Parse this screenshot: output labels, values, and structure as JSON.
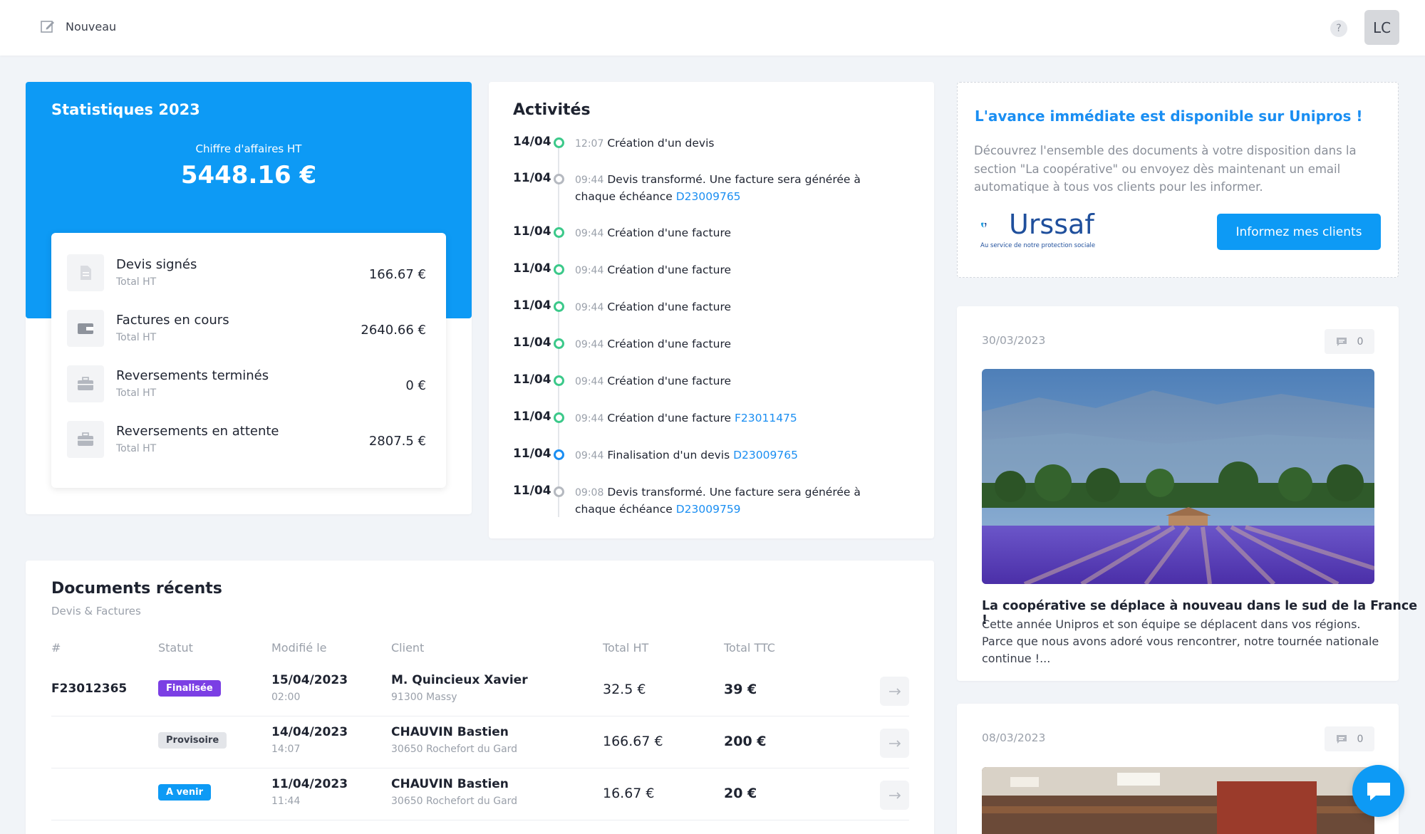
{
  "topbar": {
    "new_label": "Nouveau",
    "help_label": "?",
    "avatar_initials": "LC"
  },
  "stats": {
    "title": "Statistiques 2023",
    "ca_label": "Chiffre d'affaires HT",
    "ca_value": "5448.16 €",
    "rows": [
      {
        "name": "Devis signés",
        "sub": "Total HT",
        "value": "166.67 €",
        "icon": "document-icon"
      },
      {
        "name": "Factures en cours",
        "sub": "Total HT",
        "value": "2640.66 €",
        "icon": "wallet-icon"
      },
      {
        "name": "Reversements terminés",
        "sub": "Total HT",
        "value": "0 €",
        "icon": "briefcase-icon"
      },
      {
        "name": "Reversements en attente",
        "sub": "Total HT",
        "value": "2807.5 €",
        "icon": "briefcase-icon"
      }
    ]
  },
  "activities": {
    "title": "Activités",
    "items": [
      {
        "date": "14/04",
        "time": "12:07",
        "text": "Création d'un devis",
        "link": "",
        "dot": "green"
      },
      {
        "date": "11/04",
        "time": "09:44",
        "text": "Devis transformé. Une facture sera générée à chaque échéance",
        "link": "D23009765",
        "dot": "grey"
      },
      {
        "date": "11/04",
        "time": "09:44",
        "text": "Création d'une facture",
        "link": "",
        "dot": "green"
      },
      {
        "date": "11/04",
        "time": "09:44",
        "text": "Création d'une facture",
        "link": "",
        "dot": "green"
      },
      {
        "date": "11/04",
        "time": "09:44",
        "text": "Création d'une facture",
        "link": "",
        "dot": "green"
      },
      {
        "date": "11/04",
        "time": "09:44",
        "text": "Création d'une facture",
        "link": "",
        "dot": "green"
      },
      {
        "date": "11/04",
        "time": "09:44",
        "text": "Création d'une facture",
        "link": "",
        "dot": "green"
      },
      {
        "date": "11/04",
        "time": "09:44",
        "text": "Création d'une facture",
        "link": "F23011475",
        "dot": "green"
      },
      {
        "date": "11/04",
        "time": "09:44",
        "text": "Finalisation d'un devis",
        "link": "D23009765",
        "dot": "blue"
      },
      {
        "date": "11/04",
        "time": "09:08",
        "text": "Devis transformé. Une facture sera générée à chaque échéance",
        "link": "D23009759",
        "dot": "grey"
      }
    ]
  },
  "documents": {
    "title": "Documents récents",
    "subtitle": "Devis & Factures",
    "headers": [
      "#",
      "Statut",
      "Modifié le",
      "Client",
      "Total HT",
      "Total TTC"
    ],
    "rows": [
      {
        "num": "F23012365",
        "status": "Finalisée",
        "status_color": "#7b3fe4",
        "date": "15/04/2023",
        "time": "02:00",
        "client": "M. Quincieux Xavier",
        "address": "91300 Massy",
        "ht": "32.5 €",
        "ttc": "39 €"
      },
      {
        "num": "",
        "status": "Provisoire",
        "status_color": "#e3e5e9",
        "date": "14/04/2023",
        "time": "14:07",
        "client": "CHAUVIN Bastien",
        "address": "30650 Rochefort du Gard",
        "ht": "166.67 €",
        "ttc": "200 €"
      },
      {
        "num": "",
        "status": "A venir",
        "status_color": "#0d9af5",
        "date": "11/04/2023",
        "time": "11:44",
        "client": "CHAUVIN Bastien",
        "address": "30650 Rochefort du Gard",
        "ht": "16.67 €",
        "ttc": "20 €"
      }
    ]
  },
  "promo": {
    "title": "L'avance immédiate est disponible sur Unipros !",
    "text": "Découvrez l'ensemble des documents à votre disposition dans la section \"La coopérative\" ou envoyez dès maintenant un email automatique à tous vos clients pour les informer.",
    "logo_word": "Urssaf",
    "logo_sub": "Au service de notre protection sociale",
    "button": "Informez mes clients"
  },
  "news": [
    {
      "date": "30/03/2023",
      "comments": "0",
      "headline": "La coopérative se déplace à nouveau dans le sud de la France !",
      "body": "Cette année Unipros et son équipe se déplacent dans vos régions. Parce que nous avons adoré vous rencontrer, notre tournée nationale continue !..."
    },
    {
      "date": "08/03/2023",
      "comments": "0"
    }
  ],
  "colors": {
    "accent": "#0d9af5",
    "link": "#1a8ef2",
    "success": "#3cc98a",
    "purple": "#7b3fe4"
  }
}
